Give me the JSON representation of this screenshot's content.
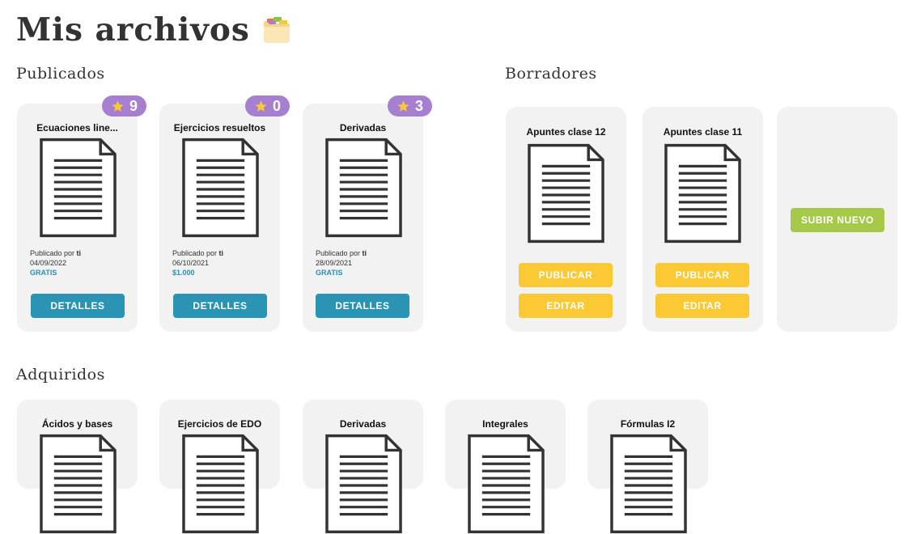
{
  "page": {
    "title": "Mis archivos",
    "folder_icon": "folder-icon"
  },
  "colors": {
    "detalles": "#2b93b4",
    "publicar": "#fbc934",
    "subir": "#a7c94a",
    "badge": "#a77fd0",
    "price": "#2a8fb5",
    "card": "#f2f2f2"
  },
  "published": {
    "title": "Publicados",
    "items": [
      {
        "title": "Ecuaciones line...",
        "stars": "9",
        "meta_prefix": "Publicado por ",
        "author": "ti",
        "date": "04/09/2022",
        "price": "GRATIS",
        "button": "DETALLES"
      },
      {
        "title": "Ejercicios resueltos",
        "stars": "0",
        "meta_prefix": "Publicado por ",
        "author": "ti",
        "date": "06/10/2021",
        "price": "$1.000",
        "button": "DETALLES"
      },
      {
        "title": "Derivadas",
        "stars": "3",
        "meta_prefix": "Publicado por ",
        "author": "ti",
        "date": "28/09/2021",
        "price": "GRATIS",
        "button": "DETALLES"
      }
    ]
  },
  "drafts": {
    "title": "Borradores",
    "items": [
      {
        "title": "Apuntes clase 12",
        "publish_button": "PUBLICAR",
        "edit_button": "EDITAR"
      },
      {
        "title": "Apuntes clase 11",
        "publish_button": "PUBLICAR",
        "edit_button": "EDITAR"
      }
    ],
    "upload_button": "SUBIR NUEVO"
  },
  "acquired": {
    "title": "Adquiridos",
    "items": [
      {
        "title": "Ácidos y bases"
      },
      {
        "title": "Ejercicios de EDO"
      },
      {
        "title": "Derivadas"
      },
      {
        "title": "Integrales"
      },
      {
        "title": "Fórmulas I2"
      }
    ]
  }
}
